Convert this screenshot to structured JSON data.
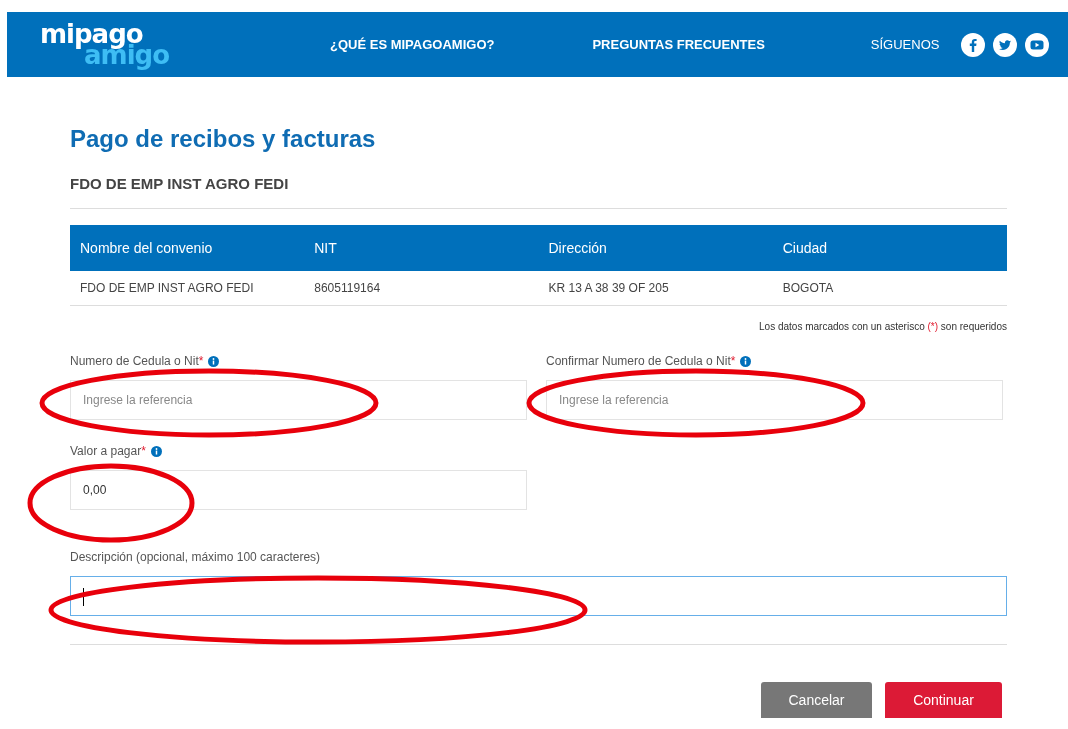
{
  "header": {
    "logo": {
      "line1": "mipago",
      "line2": "amigo"
    },
    "nav": [
      {
        "label": "¿QUÉ ES MIPAGOAMIGO?"
      },
      {
        "label": "PREGUNTAS FRECUENTES"
      }
    ],
    "follow_label": "SÍGUENOS",
    "social": [
      {
        "kind": "facebook"
      },
      {
        "kind": "twitter"
      },
      {
        "kind": "youtube"
      }
    ]
  },
  "title": "Pago de recibos y facturas",
  "subtitle": "FDO DE EMP INST AGRO FEDI",
  "table": {
    "columns": [
      "Nombre del convenio",
      "NIT",
      "Dirección",
      "Ciudad"
    ],
    "rows": [
      [
        "FDO DE EMP INST AGRO FEDI",
        "8605119164",
        "KR 13 A 38 39 OF 205",
        "BOGOTA"
      ]
    ]
  },
  "required_note": {
    "before": "Los datos marcados con un asterisco ",
    "mark": "(*)",
    "after": " son requeridos"
  },
  "fields": [
    {
      "label": "Numero de Cedula o Nit",
      "required_mark": "*",
      "info": true,
      "placeholder": "Ingrese la referencia",
      "focused": false,
      "kind": "half"
    },
    {
      "label": "Confirmar Numero de Cedula o Nit",
      "required_mark": "*",
      "info": true,
      "placeholder": "Ingrese la referencia",
      "focused": false,
      "kind": "half"
    },
    {
      "label": "Valor a pagar",
      "required_mark": "*",
      "info": true,
      "value": "0,00",
      "focused": false,
      "kind": "half"
    },
    {
      "label": "Descripción (opcional, máximo 100 caracteres)",
      "info": false,
      "focused": true,
      "kind": "full"
    }
  ],
  "buttons": [
    {
      "label": "Cancelar",
      "kind": "secondary"
    },
    {
      "label": "Continuar",
      "kind": "primary"
    }
  ]
}
